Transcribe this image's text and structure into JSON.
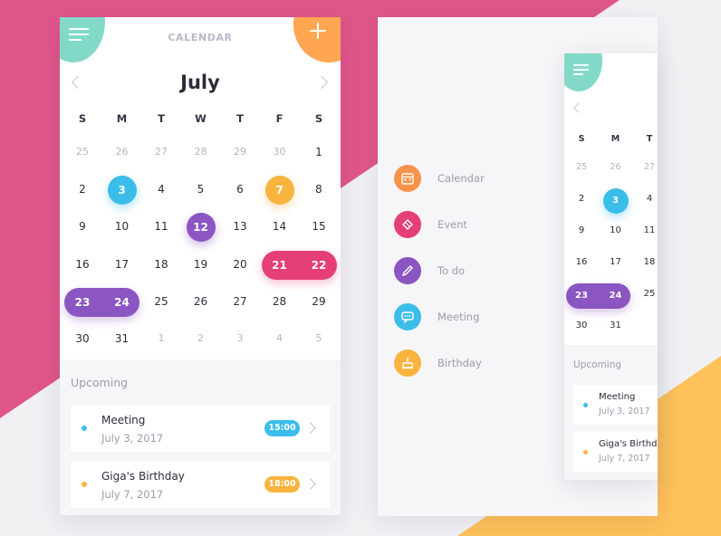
{
  "colors": {
    "pink": "#e0568a",
    "orange": "#ffc15a",
    "teal": "#83d9c8",
    "blue": "#3bbdea",
    "amber": "#f8b43f",
    "purple": "#8b55c2",
    "red": "#e53f77"
  },
  "calendar": {
    "title": "CALENDAR",
    "month": "July",
    "weekdays": [
      "S",
      "M",
      "T",
      "W",
      "T",
      "F",
      "S"
    ],
    "weeks": [
      [
        "25",
        "26",
        "27",
        "28",
        "29",
        "30",
        "1"
      ],
      [
        "2",
        "3",
        "4",
        "5",
        "6",
        "7",
        "8"
      ],
      [
        "9",
        "10",
        "11",
        "12",
        "13",
        "14",
        "15"
      ],
      [
        "16",
        "17",
        "18",
        "19",
        "20",
        "21",
        "22"
      ],
      [
        "23",
        "24",
        "25",
        "26",
        "27",
        "28",
        "29"
      ],
      [
        "30",
        "31",
        "1",
        "2",
        "3",
        "4",
        "5"
      ]
    ],
    "highlights": [
      {
        "day": "3",
        "style": "circle",
        "color": "blue"
      },
      {
        "day": "7",
        "style": "circle",
        "color": "amber"
      },
      {
        "day": "12",
        "style": "circle",
        "color": "purple"
      },
      {
        "range": [
          "21",
          "22"
        ],
        "style": "pill",
        "color": "red"
      },
      {
        "range": [
          "23",
          "24"
        ],
        "style": "pill",
        "color": "purple"
      }
    ]
  },
  "upcoming": {
    "label": "Upcoming",
    "events": [
      {
        "title": "Meeting",
        "date": "July 3, 2017",
        "time": "15:00",
        "dot": "#3bbdea",
        "badge": "#3bbdea"
      },
      {
        "title": "Giga's Birthday",
        "date": "July 7, 2017",
        "time": "18:00",
        "dot": "#f8b43f",
        "badge": "#f8b43f"
      }
    ]
  },
  "menu": {
    "items": [
      {
        "label": "Calendar",
        "icon": "calendar-icon",
        "color": "#f7934a"
      },
      {
        "label": "Event",
        "icon": "ticket-icon",
        "color": "#e53f77"
      },
      {
        "label": "To do",
        "icon": "pencil-icon",
        "color": "#8b55c2"
      },
      {
        "label": "Meeting",
        "icon": "chat-bubble-icon",
        "color": "#3bbdea"
      },
      {
        "label": "Birthday",
        "icon": "cake-icon",
        "color": "#f8b43f"
      }
    ]
  },
  "small_preview": {
    "weekdays": [
      "S",
      "M",
      "T"
    ],
    "weeks": [
      [
        "25",
        "26",
        "27"
      ],
      [
        "2",
        "3",
        "4"
      ],
      [
        "9",
        "10",
        "11"
      ],
      [
        "16",
        "17",
        "18"
      ],
      [
        "23",
        "24",
        "25"
      ],
      [
        "30",
        "31",
        ""
      ]
    ],
    "upcoming_label": "Upcoming",
    "events": [
      {
        "title": "Meeting",
        "date": "July 3, 2017",
        "dot": "#3bbdea"
      },
      {
        "title": "Giga's Birthday",
        "date": "July 7, 2017",
        "dot": "#f8b43f"
      }
    ]
  }
}
